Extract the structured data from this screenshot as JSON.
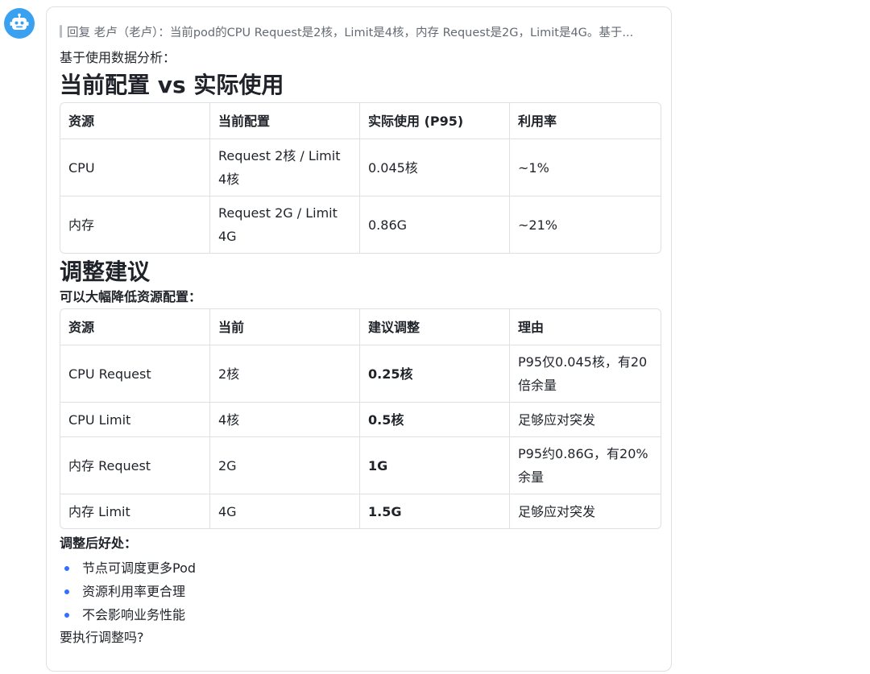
{
  "avatar": {
    "icon": "robot-icon",
    "color": "#3aa0f0"
  },
  "message": {
    "quote": "回复 老卢（老卢）：当前pod的CPU Request是2核，Limit是4核，内存 Request是2G，Limit是4G。基于...",
    "intro": "基于使用数据分析：",
    "section1_title": "当前配置 vs 实际使用",
    "table1": {
      "headers": [
        "资源",
        "当前配置",
        "实际使用 (P95)",
        "利用率"
      ],
      "rows": [
        [
          "CPU",
          "Request 2核 / Limit 4核",
          "0.045核",
          "~1%"
        ],
        [
          "内存",
          "Request 2G / Limit 4G",
          "0.86G",
          "~21%"
        ]
      ]
    },
    "section2_title": "调整建议",
    "section2_lead": "可以大幅降低资源配置：",
    "table2": {
      "headers": [
        "资源",
        "当前",
        "建议调整",
        "理由"
      ],
      "rows": [
        [
          "CPU Request",
          "2核",
          "0.25核",
          "P95仅0.045核，有20倍余量"
        ],
        [
          "CPU Limit",
          "4核",
          "0.5核",
          "足够应对突发"
        ],
        [
          "内存 Request",
          "2G",
          "1G",
          "P95约0.86G，有20%余量"
        ],
        [
          "内存 Limit",
          "4G",
          "1.5G",
          "足够应对突发"
        ]
      ]
    },
    "benefits_title": "调整后好处：",
    "benefits": [
      "节点可调度更多Pod",
      "资源利用率更合理",
      "不会影响业务性能"
    ],
    "question": "要执行调整吗?"
  }
}
